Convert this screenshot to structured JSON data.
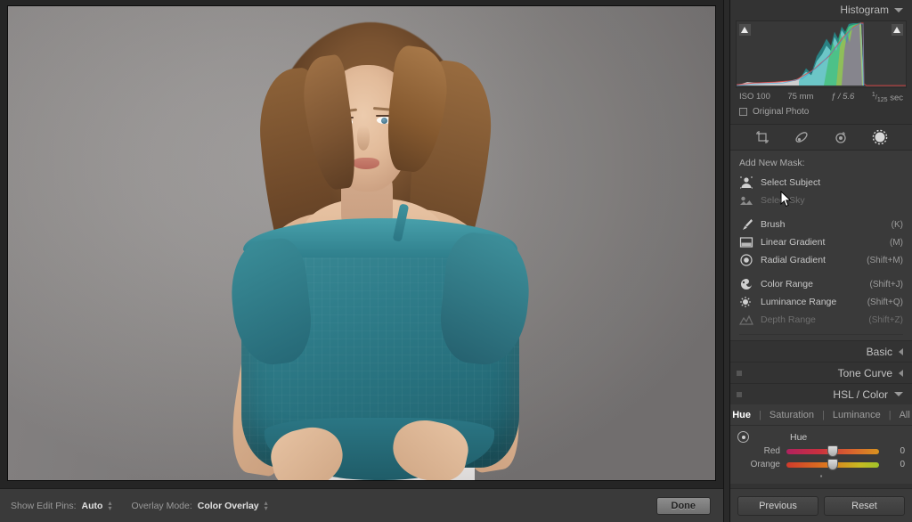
{
  "histogram": {
    "title": "Histogram",
    "exif": {
      "iso": "ISO 100",
      "focal_length": "75 mm",
      "aperture": "ƒ / 5.6",
      "shutter_numerator": "1",
      "shutter_denominator": "125",
      "shutter_suffix": "sec"
    },
    "original_photo_label": "Original Photo"
  },
  "tools": [
    {
      "name": "crop-overlay-tool",
      "active": false
    },
    {
      "name": "spot-removal-tool",
      "active": false
    },
    {
      "name": "red-eye-tool",
      "active": false
    },
    {
      "name": "masking-tool",
      "active": true
    }
  ],
  "masking": {
    "add_new_mask_label": "Add New Mask:",
    "items": [
      {
        "label": "Select Subject",
        "shortcut": "",
        "icon": "person-icon",
        "dim": false,
        "group": 0
      },
      {
        "label": "Select Sky",
        "shortcut": "",
        "icon": "sky-icon",
        "dim": true,
        "group": 0
      },
      {
        "label": "Brush",
        "shortcut": "(K)",
        "icon": "brush-icon",
        "dim": false,
        "group": 1
      },
      {
        "label": "Linear Gradient",
        "shortcut": "(M)",
        "icon": "linear-gradient-icon",
        "dim": false,
        "group": 1
      },
      {
        "label": "Radial Gradient",
        "shortcut": "(Shift+M)",
        "icon": "radial-gradient-icon",
        "dim": false,
        "group": 1
      },
      {
        "label": "Color Range",
        "shortcut": "(Shift+J)",
        "icon": "color-range-icon",
        "dim": false,
        "group": 2
      },
      {
        "label": "Luminance Range",
        "shortcut": "(Shift+Q)",
        "icon": "luminance-range-icon",
        "dim": false,
        "group": 2
      },
      {
        "label": "Depth Range",
        "shortcut": "(Shift+Z)",
        "icon": "depth-range-icon",
        "dim": true,
        "group": 2
      }
    ]
  },
  "panels": {
    "basic": "Basic",
    "tone_curve": "Tone Curve",
    "hsl_color": "HSL / Color"
  },
  "hsl": {
    "tabs": [
      "Hue",
      "Saturation",
      "Luminance",
      "All"
    ],
    "active_tab": "Hue",
    "section_label": "Hue",
    "sliders": [
      {
        "name": "Red",
        "value": "0"
      },
      {
        "name": "Orange",
        "value": "0"
      }
    ]
  },
  "toolbar": {
    "show_edit_pins_label": "Show Edit Pins:",
    "show_edit_pins_value": "Auto",
    "overlay_mode_label": "Overlay Mode:",
    "overlay_mode_value": "Color Overlay",
    "done_label": "Done"
  },
  "right_bottom": {
    "previous_label": "Previous",
    "reset_label": "Reset"
  },
  "colors": {
    "panel_bg": "#333333",
    "subpanel_bg": "#3a3a3a",
    "blouse_teal": "#2f7d8a",
    "backdrop_gray": "#9b9897"
  }
}
